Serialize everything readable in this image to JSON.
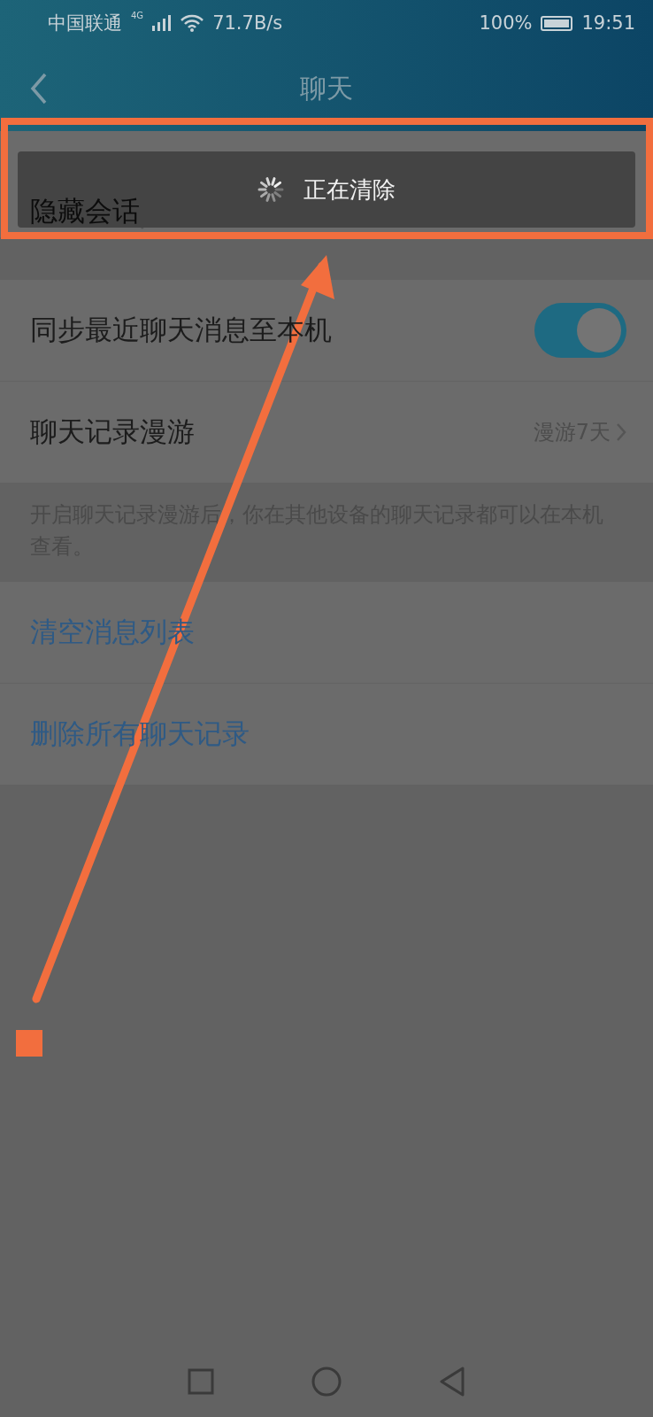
{
  "status_bar": {
    "carrier": "中国联通",
    "network": "4G",
    "speed": "71.7B/s",
    "battery": "100%",
    "time": "19:51"
  },
  "header": {
    "title": "聊天"
  },
  "sections": [
    {
      "rows": [
        {
          "kind": "link",
          "label": "隐藏会话"
        }
      ]
    },
    {
      "rows": [
        {
          "kind": "toggle",
          "label": "同步最近聊天消息至本机",
          "on": true
        },
        {
          "kind": "link",
          "label": "聊天记录漫游",
          "value": "漫游7天"
        }
      ],
      "note": "开启聊天记录漫游后，你在其他设备的聊天记录都可以在本机查看。"
    },
    {
      "rows": [
        {
          "kind": "action",
          "label": "清空消息列表"
        },
        {
          "kind": "action",
          "label": "删除所有聊天记录"
        }
      ]
    }
  ],
  "toast": {
    "text": "正在清除"
  }
}
